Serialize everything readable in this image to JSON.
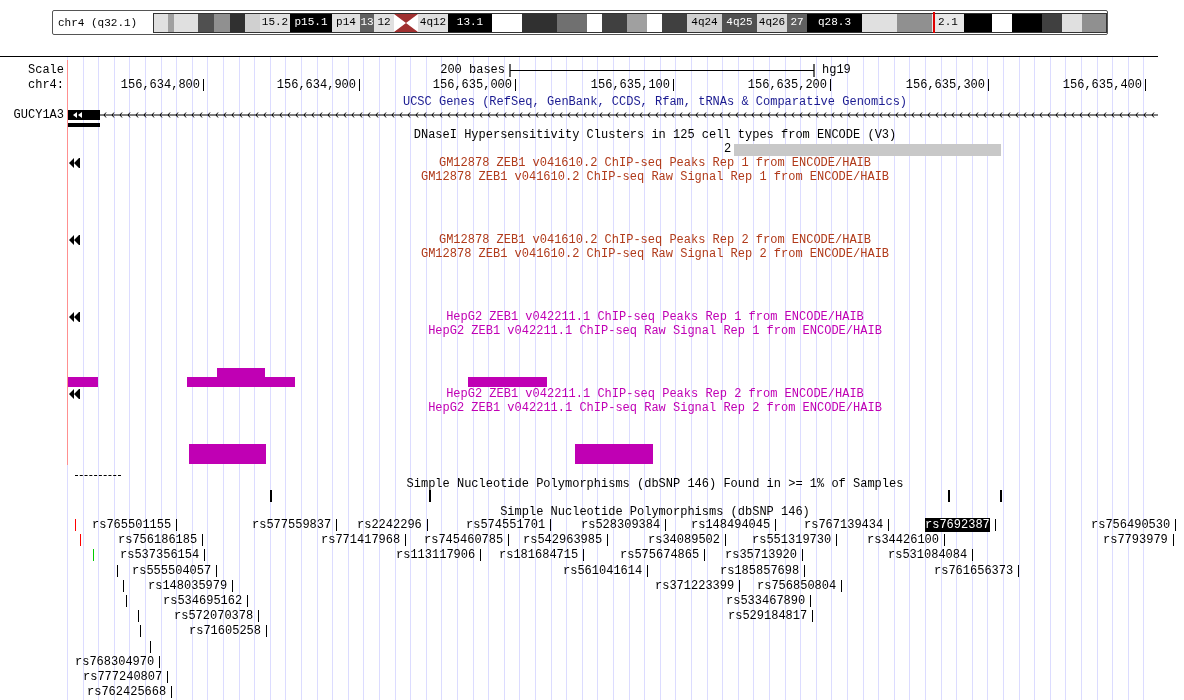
{
  "ideogram": {
    "chromosome": "chr4 (q32.1)",
    "bands": [
      {
        "color": "#e0e0e0"
      },
      {
        "color": "#a0a0a0"
      },
      {
        "color": "#e0e0e0"
      },
      {
        "color": "#505050"
      },
      {
        "color": "#909090"
      },
      {
        "color": "#303030"
      },
      {
        "color": "#d0d0d0"
      },
      {
        "label": "15.2",
        "color": "#e0e0e0"
      },
      {
        "label": "p15.1",
        "color": "#000000"
      },
      {
        "label": "p14",
        "color": "#e0e0e0"
      },
      {
        "label": "13",
        "color": "#606060"
      },
      {
        "label": "12",
        "color": "#e0e0e0"
      },
      {
        "kind": "centromere",
        "color": "#a03030"
      },
      {
        "label": "4q12",
        "color": "#e0e0e0"
      },
      {
        "label": "13.1",
        "color": "#000000"
      },
      {
        "color": "#ffffff"
      },
      {
        "color": "#303030"
      },
      {
        "color": "#707070"
      },
      {
        "color": "#ffffff"
      },
      {
        "color": "#404040"
      },
      {
        "color": "#a0a0a0"
      },
      {
        "color": "#ffffff"
      },
      {
        "color": "#404040"
      },
      {
        "label": "4q24",
        "color": "#d0d0d0"
      },
      {
        "label": "4q25",
        "color": "#505050"
      },
      {
        "label": "4q26",
        "color": "#d8d8d8"
      },
      {
        "label": "27",
        "color": "#606060"
      },
      {
        "label": "q28.3",
        "color": "#000000"
      },
      {
        "color": "#e0e0e0"
      },
      {
        "color": "#909090"
      },
      {
        "label": "2.1",
        "color": "#e8e8e8"
      },
      {
        "color": "#000000"
      },
      {
        "color": "#ffffff"
      },
      {
        "color": "#000000"
      },
      {
        "color": "#404040"
      },
      {
        "color": "#e0e0e0"
      },
      {
        "color": "#909090"
      }
    ]
  },
  "scale": {
    "label": "Scale",
    "chrom_label": "chr4:",
    "span": "200 bases",
    "assembly": "hg19",
    "positions": [
      "156,634,800",
      "156,634,900",
      "156,635,000",
      "156,635,100",
      "156,635,200",
      "156,635,300",
      "156,635,400"
    ]
  },
  "gene_track": {
    "title": "UCSC Genes (RefSeq, GenBank, CCDS, Rfam, tRNAs & Comparative Genomics)",
    "gene": "GUCY1A3"
  },
  "dnase_track": {
    "title": "DNaseI Hypersensitivity Clusters in 125 cell types from ENCODE (V3)",
    "score": "2"
  },
  "chip_tracks": [
    {
      "peaks_title": "GM12878 ZEB1 v041610.2 ChIP-seq Peaks Rep 1 from ENCODE/HAIB",
      "signal_title": "GM12878 ZEB1 v041610.2 ChIP-seq Raw Signal Rep 1 from ENCODE/HAIB",
      "color": "#b03a1a"
    },
    {
      "peaks_title": "GM12878 ZEB1 v041610.2 ChIP-seq Peaks Rep 2 from ENCODE/HAIB",
      "signal_title": "GM12878 ZEB1 v041610.2 ChIP-seq Raw Signal Rep 2 from ENCODE/HAIB",
      "color": "#b03a1a"
    },
    {
      "peaks_title": "HepG2 ZEB1 v042211.1 ChIP-seq Peaks Rep 1 from ENCODE/HAIB",
      "signal_title": "HepG2 ZEB1 v042211.1 ChIP-seq Raw Signal Rep 1 from ENCODE/HAIB",
      "color": "#c000b4"
    },
    {
      "peaks_title": "HepG2 ZEB1 v042211.1 ChIP-seq Peaks Rep 2 from ENCODE/HAIB",
      "signal_title": "HepG2 ZEB1 v042211.1 ChIP-seq Raw Signal Rep 2 from ENCODE/HAIB",
      "color": "#c000b4"
    }
  ],
  "common_snp_track": {
    "title": "Simple Nucleotide Polymorphisms (dbSNP 146) Found in >= 1% of Samples"
  },
  "snp_track": {
    "title": "Simple Nucleotide Polymorphisms (dbSNP 146)",
    "items": [
      {
        "kind": "tick",
        "color": "#ff0000"
      },
      {
        "kind": "snp",
        "name": "rs765501155",
        "selected": false
      },
      {
        "kind": "snp",
        "name": "rs577559837",
        "selected": false
      },
      {
        "kind": "snp",
        "name": "rs2242296",
        "selected": false
      },
      {
        "kind": "snp",
        "name": "rs574551701",
        "selected": false
      },
      {
        "kind": "snp",
        "name": "rs528309384",
        "selected": false
      },
      {
        "kind": "snp",
        "name": "rs148494045",
        "selected": false
      },
      {
        "kind": "snp",
        "name": "rs767139434",
        "selected": false
      },
      {
        "kind": "snp",
        "name": "rs7692387",
        "selected": true
      },
      {
        "kind": "snp",
        "name": "rs756490530",
        "selected": false
      },
      {
        "kind": "tick",
        "color": "#ff0000"
      },
      {
        "kind": "snp",
        "name": "rs756186185",
        "selected": false
      },
      {
        "kind": "snp",
        "name": "rs771417968",
        "selected": false
      },
      {
        "kind": "snp",
        "name": "rs745460785",
        "selected": false
      },
      {
        "kind": "snp",
        "name": "rs542963985",
        "selected": false
      },
      {
        "kind": "snp",
        "name": "rs34089502",
        "selected": false
      },
      {
        "kind": "snp",
        "name": "rs551319730",
        "selected": false
      },
      {
        "kind": "snp",
        "name": "rs34426100",
        "selected": false
      },
      {
        "kind": "snp",
        "name": "rs7793979",
        "selected": false
      },
      {
        "kind": "tick",
        "color": "#00cc00"
      },
      {
        "kind": "snp",
        "name": "rs537356154",
        "selected": false
      },
      {
        "kind": "snp",
        "name": "rs113117906",
        "selected": false
      },
      {
        "kind": "snp",
        "name": "rs181684715",
        "selected": false
      },
      {
        "kind": "snp",
        "name": "rs575674865",
        "selected": false
      },
      {
        "kind": "snp",
        "name": "rs35713920",
        "selected": false
      },
      {
        "kind": "snp",
        "name": "rs531084084",
        "selected": false
      },
      {
        "kind": "tick",
        "color": "#000000"
      },
      {
        "kind": "snp",
        "name": "rs555504057",
        "selected": false
      },
      {
        "kind": "snp",
        "name": "rs561041614",
        "selected": false
      },
      {
        "kind": "snp",
        "name": "rs185857698",
        "selected": false
      },
      {
        "kind": "snp",
        "name": "rs761656373",
        "selected": false
      },
      {
        "kind": "tick",
        "color": "#000000"
      },
      {
        "kind": "snp",
        "name": "rs148035979",
        "selected": false
      },
      {
        "kind": "snp",
        "name": "rs371223399",
        "selected": false
      },
      {
        "kind": "snp",
        "name": "rs756850804",
        "selected": false
      },
      {
        "kind": "tick",
        "color": "#000000"
      },
      {
        "kind": "snp",
        "name": "rs534695162",
        "selected": false
      },
      {
        "kind": "snp",
        "name": "rs533467890",
        "selected": false
      },
      {
        "kind": "tick",
        "color": "#000000"
      },
      {
        "kind": "snp",
        "name": "rs572070378",
        "selected": false
      },
      {
        "kind": "snp",
        "name": "rs529184817",
        "selected": false
      },
      {
        "kind": "tick",
        "color": "#000000"
      },
      {
        "kind": "snp",
        "name": "rs71605258",
        "selected": false
      },
      {
        "kind": "tick",
        "color": "#000000"
      },
      {
        "kind": "snp",
        "name": "rs768304970",
        "selected": false
      },
      {
        "kind": "snp",
        "name": "rs777240807",
        "selected": false
      },
      {
        "kind": "snp",
        "name": "rs762425668",
        "selected": false
      }
    ]
  }
}
